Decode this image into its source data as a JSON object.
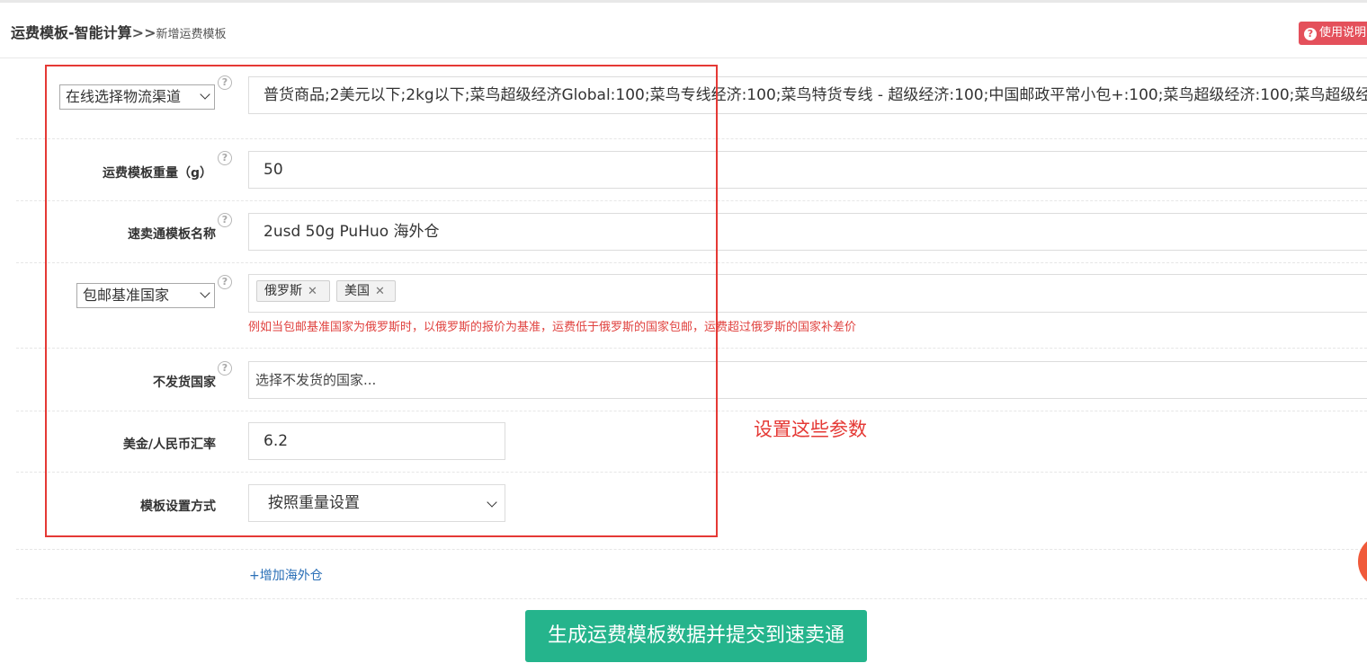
{
  "header": {
    "title": "运费模板-智能计算",
    "separator": ">>",
    "subtitle": "新增运费模板",
    "help_label": "使用说明"
  },
  "form": {
    "logistics": {
      "select_value": "在线选择物流渠道",
      "value": "普货商品;2美元以下;2kg以下;菜鸟超级经济Global:100;菜鸟专线经济:100;菜鸟特货专线 - 超级经济:100;中国邮政平常小包+:100;菜鸟超级经济:100;菜鸟超级经"
    },
    "weight": {
      "label": "运费模板重量（g）",
      "value": "50"
    },
    "template_name": {
      "label": "速卖通模板名称",
      "value": "2usd 50g PuHuo 海外仓"
    },
    "base_country": {
      "select_value": "包邮基准国家",
      "tags": [
        "俄罗斯",
        "美国"
      ],
      "hint": "例如当包邮基准国家为俄罗斯时，以俄罗斯的报价为基准，运费低于俄罗斯的国家包邮，运费超过俄罗斯的国家补差价"
    },
    "no_ship": {
      "label": "不发货国家",
      "placeholder": "选择不发货的国家..."
    },
    "exchange_rate": {
      "label": "美金/人民币汇率",
      "value": "6.2"
    },
    "setting_mode": {
      "label": "模板设置方式",
      "value": "按照重量设置"
    }
  },
  "help_mark": "?",
  "tag_remove": "✕",
  "annotation": "设置这些参数",
  "add_warehouse": "+增加海外仓",
  "submit_label": "生成运费模板数据并提交到速卖通",
  "colors": {
    "accent_green": "#25b48c",
    "annotation_red": "#e53935",
    "help_red": "#e4505b",
    "link_blue": "#2a6fb7"
  }
}
